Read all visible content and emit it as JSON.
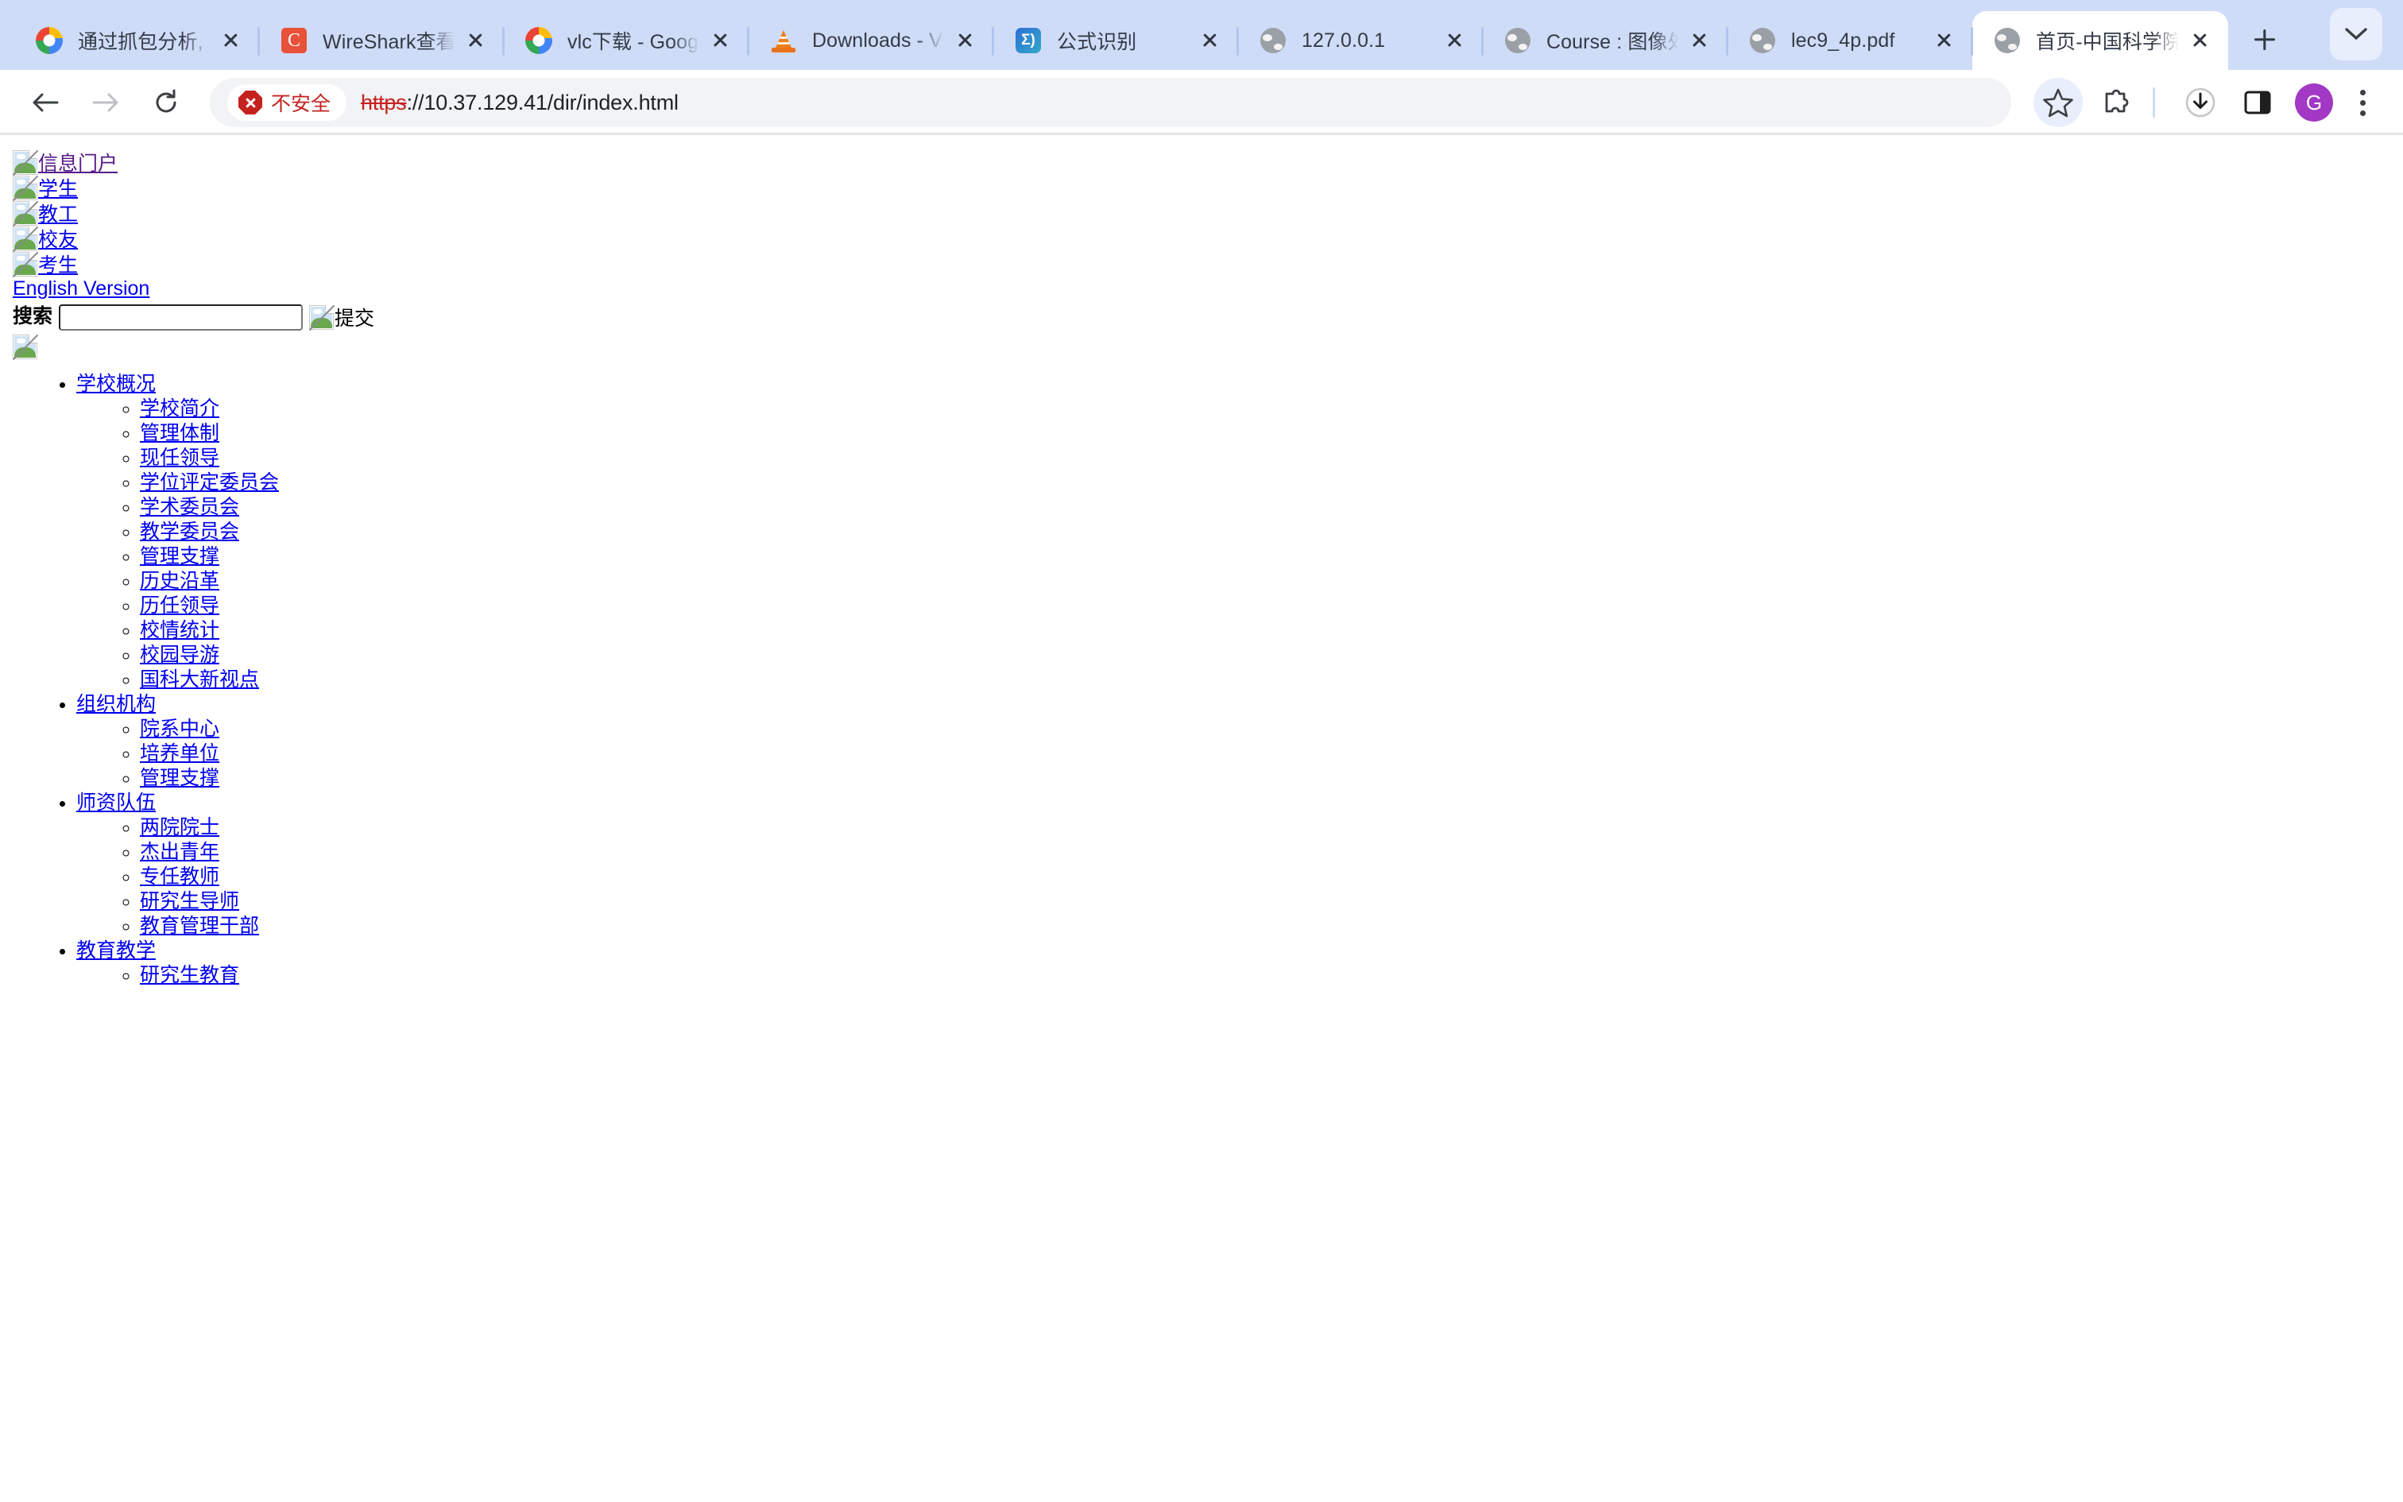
{
  "browser": {
    "tabs": [
      {
        "title": "通过抓包分析,",
        "favicon": "google-icon"
      },
      {
        "title": "WireShark查看",
        "favicon": "csdn-icon"
      },
      {
        "title": "vlc下载 - Goog",
        "favicon": "google-icon"
      },
      {
        "title": "Downloads - V",
        "favicon": "vlc-cone-icon"
      },
      {
        "title": "公式识别",
        "favicon": "sigma-icon"
      },
      {
        "title": "127.0.0.1",
        "favicon": "globe-icon"
      },
      {
        "title": "Course : 图像处",
        "favicon": "globe-icon"
      },
      {
        "title": "lec9_4p.pdf",
        "favicon": "globe-icon"
      },
      {
        "title": "首页-中国科学院",
        "favicon": "globe-icon"
      }
    ],
    "active_tab_index": 8,
    "new_tab_label": "+",
    "tab_list_chevron": "⌄",
    "toolbar": {
      "back_icon": "←",
      "forward_icon": "→",
      "reload_icon": "⟳",
      "security_label": "不安全",
      "url_scheme": "https",
      "url_rest": "://10.37.129.41/dir/index.html",
      "bookmark_icon": "star-icon",
      "extensions_icon": "puzzle-icon",
      "download_icon": "download-icon",
      "sidepanel_icon": "side-panel-icon",
      "avatar_letter": "G",
      "menu_icon": "three-dot-menu-icon"
    },
    "accent_colors": {
      "tabstrip_bg": "#cfdcf7",
      "active_tab_bg": "#ffffff",
      "security_red": "#c5221f",
      "avatar_purple": "#a238c4",
      "link_blue": "#0000ee",
      "link_visited": "#551a8b"
    }
  },
  "page": {
    "portal_links": [
      {
        "label": "信息门户",
        "visited": true
      },
      {
        "label": "学生",
        "visited": false
      },
      {
        "label": "教工",
        "visited": false
      },
      {
        "label": "校友",
        "visited": false
      },
      {
        "label": "考生",
        "visited": false
      }
    ],
    "english_version": "English Version",
    "search": {
      "label": "搜索",
      "value": "",
      "submit_label": "提交"
    },
    "nav": [
      {
        "label": "学校概况",
        "children": [
          "学校简介",
          "管理体制",
          "现任领导",
          "学位评定委员会",
          "学术委员会",
          "教学委员会",
          "管理支撑",
          "历史沿革",
          "历任领导",
          "校情统计",
          "校园导游",
          "国科大新视点"
        ]
      },
      {
        "label": "组织机构",
        "children": [
          "院系中心",
          "培养单位",
          "管理支撑"
        ]
      },
      {
        "label": "师资队伍",
        "children": [
          "两院院士",
          "杰出青年",
          "专任教师",
          "研究生导师",
          "教育管理干部"
        ]
      },
      {
        "label": "教育教学",
        "children": [
          "研究生教育"
        ]
      }
    ]
  }
}
